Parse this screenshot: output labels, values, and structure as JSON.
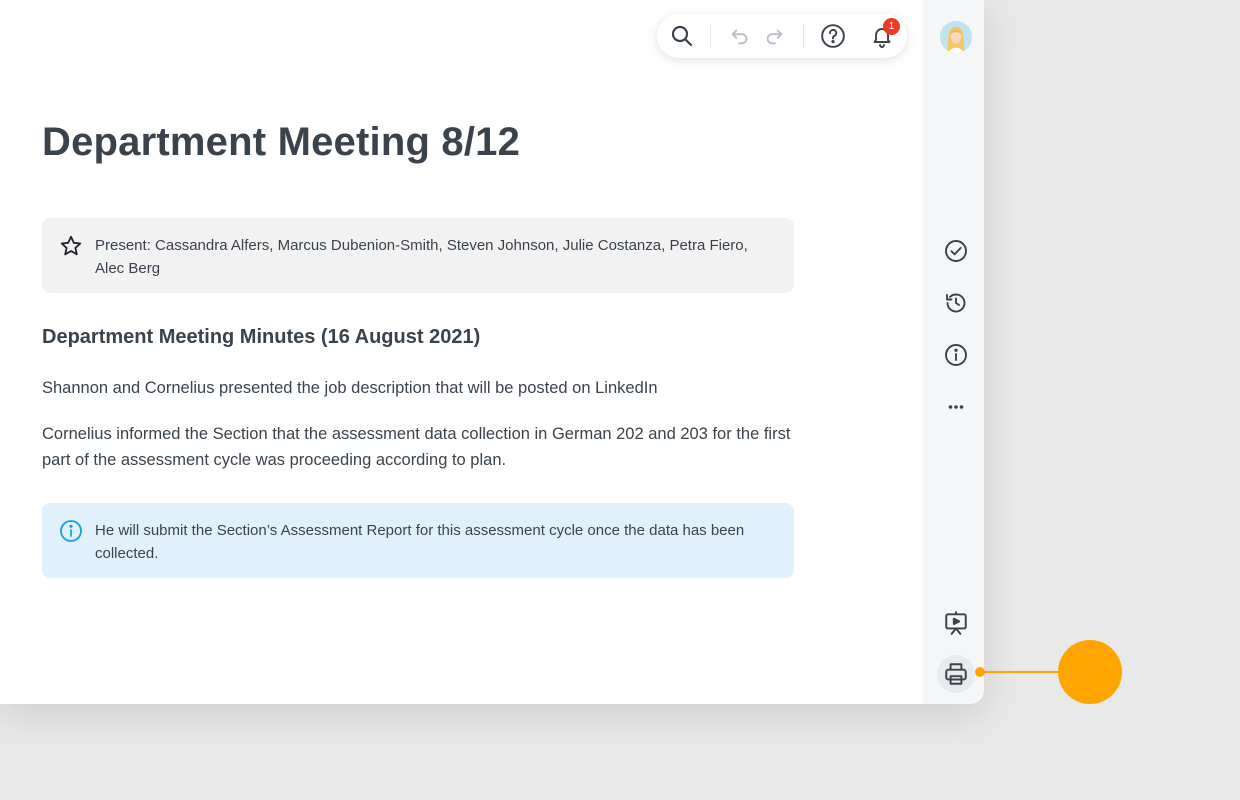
{
  "document": {
    "title": "Department Meeting 8/12",
    "present_callout": "Present: Cassandra Alfers, Marcus Dubenion-Smith, Steven Johnson, Julie Costanza, Petra Fiero, Alec Berg",
    "section_heading": "Department Meeting Minutes (16 August 2021)",
    "paragraphs": [
      "Shannon and Cornelius presented the job description that will be posted on LinkedIn",
      "Cornelius informed the Section that the assessment data collection in German 202 and 203 for the first part of the assessment cycle was proceeding according to plan."
    ],
    "info_callout": "He will submit the Section’s Assessment Report for this assessment cycle once the data has been collected."
  },
  "toolbar": {
    "icons": [
      "search-icon",
      "undo-icon",
      "redo-icon",
      "help-icon",
      "bell-icon"
    ],
    "notification_count": "1"
  },
  "sidebar": {
    "icons": [
      "check-circle-icon",
      "history-icon",
      "info-icon",
      "more-icon",
      "present-icon",
      "print-icon"
    ],
    "active": "print-icon"
  },
  "colors": {
    "accent": "#ffa500",
    "badge": "#ee3b27",
    "info_bg": "#e1f1fc",
    "info_icon": "#1a9de0",
    "text": "#3a434c"
  }
}
